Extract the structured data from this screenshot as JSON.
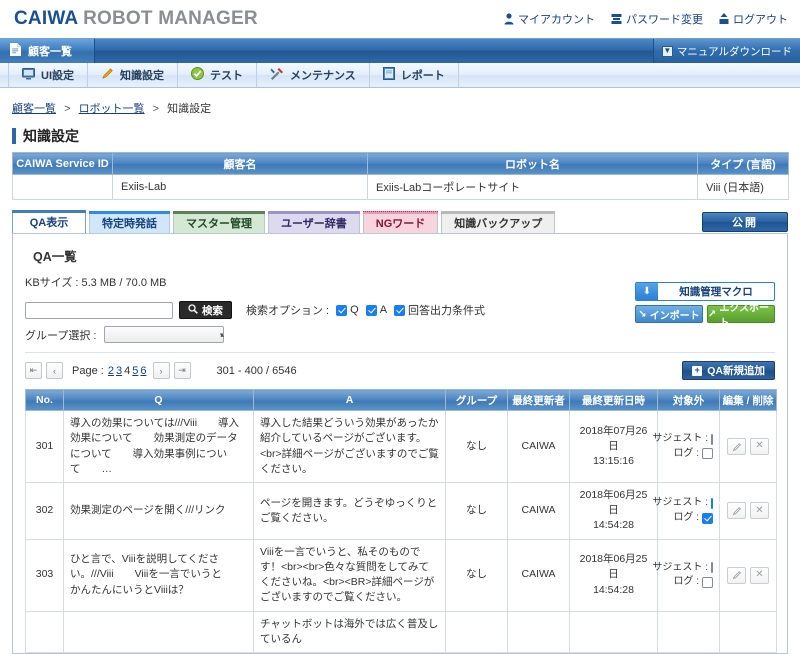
{
  "header": {
    "brand_primary": "CAIWA",
    "brand_secondary": "ROBOT MANAGER",
    "links": [
      {
        "label": "マイアカウント",
        "icon": "user-icon"
      },
      {
        "label": "パスワード変更",
        "icon": "keyboard-icon"
      },
      {
        "label": "ログアウト",
        "icon": "logout-icon"
      }
    ]
  },
  "navbar": {
    "active_tab": "顧客一覧",
    "manual_download": "マニュアルダウンロード",
    "items": [
      {
        "label": "UI設定",
        "icon": "monitor-icon"
      },
      {
        "label": "知識設定",
        "icon": "pencil-icon"
      },
      {
        "label": "テスト",
        "icon": "check-circle-icon"
      },
      {
        "label": "メンテナンス",
        "icon": "tools-icon"
      },
      {
        "label": "レポート",
        "icon": "book-icon"
      }
    ]
  },
  "breadcrumb": {
    "item1": "顧客一覧",
    "sep1": ">",
    "item2": "ロボット一覧",
    "sep2": ">",
    "current": "知識設定"
  },
  "page_title": "知識設定",
  "info_table": {
    "headers": [
      "CAIWA Service ID",
      "顧客名",
      "ロボット名",
      "タイプ (言語)"
    ],
    "row": [
      "",
      "Exiis-Lab",
      "Exiis-Labコーポレートサイト",
      "Viii (日本語)"
    ]
  },
  "tabs": [
    {
      "label": "QA表示",
      "style": "active"
    },
    {
      "label": "特定時発話",
      "style": "t-blue"
    },
    {
      "label": "マスター管理",
      "style": "t-green"
    },
    {
      "label": "ユーザー辞書",
      "style": "t-purple"
    },
    {
      "label": "NGワード",
      "style": "t-pink"
    },
    {
      "label": "知識バックアップ",
      "style": "t-grey"
    }
  ],
  "publish_button": "公開",
  "panel": {
    "title": "QA一覧",
    "kb_size": "KBサイズ : 5.3 MB / 70.0 MB",
    "search": {
      "value": "",
      "placeholder": "",
      "button_label": "検索",
      "button_icon": "search-icon",
      "options_label": "検索オプション :",
      "options": [
        {
          "label": "Q",
          "checked": true
        },
        {
          "label": "A",
          "checked": true
        },
        {
          "label": "回答出力条件式",
          "checked": true
        }
      ]
    },
    "group_select": {
      "label": "グループ選択 :",
      "value": ""
    },
    "macro": {
      "main_label": "知識管理マクロ",
      "main_icon": "download-icon",
      "import_label": "インポート",
      "import_icon": "import-icon",
      "export_label": "エクスポート",
      "export_icon": "export-icon"
    },
    "pagination": {
      "first_icon": "⏪",
      "prev_icon": "‹",
      "next_icon": "›",
      "last_icon": "⏩",
      "label": "Page :",
      "pages": [
        {
          "num": "2",
          "current": false
        },
        {
          "num": "3",
          "current": false
        },
        {
          "num": "4",
          "current": true
        },
        {
          "num": "5",
          "current": false
        },
        {
          "num": "6",
          "current": false
        }
      ],
      "range": "301 - 400 / 6546"
    },
    "add_button": {
      "label": "QA新規追加",
      "icon": "plus-icon"
    }
  },
  "qa_table": {
    "headers": [
      "No.",
      "Q",
      "A",
      "グループ",
      "最終更新者",
      "最終更新日時",
      "対象外",
      "編集 / 削除"
    ],
    "target_labels": {
      "suggest": "サジェスト :",
      "log": "ログ :"
    },
    "rows": [
      {
        "no": "301",
        "q": "導入の効果については///Viii　　導入効果について　　効果測定のデータについて　　導入効果事例について　　…",
        "a": "導入した結果どういう効果があったか紹介しているページがございます。<br>詳細ページがございますのでご覧ください。",
        "group": "なし",
        "updater": "CAIWA",
        "updated_date": "2018年07月26日",
        "updated_time": "13:15:16",
        "suggest_checked": false,
        "log_checked": false,
        "edit_icon": "pencil-icon",
        "delete_icon": "close-icon"
      },
      {
        "no": "302",
        "q": "効果測定のページを開く///リンク",
        "a": "ページを開きます。どうぞゆっくりとご覧ください。",
        "group": "なし",
        "updater": "CAIWA",
        "updated_date": "2018年06月25日",
        "updated_time": "14:54:28",
        "suggest_checked": true,
        "log_checked": true,
        "edit_icon": "pencil-icon",
        "delete_icon": "close-icon"
      },
      {
        "no": "303",
        "q": "ひと言で、Viiiを説明してください。///Viii　　Viiiを一言でいうと　　かんたんにいうとViiiは？",
        "a": "Viiiを一言でいうと、私そのものです！<br><br>色々な質問をしてみてくださいね。<br><BR>詳細ページがございますのでご覧ください。",
        "group": "なし",
        "updater": "CAIWA",
        "updated_date": "2018年06月25日",
        "updated_time": "14:54:28",
        "suggest_checked": false,
        "log_checked": false,
        "edit_icon": "pencil-icon",
        "delete_icon": "close-icon"
      },
      {
        "no": "",
        "q": "",
        "a": "チャットボットは海外では広く普及しているん",
        "group": "",
        "updater": "",
        "updated_date": "",
        "updated_time": "",
        "suggest_checked": false,
        "log_checked": false,
        "edit_icon": "",
        "delete_icon": ""
      }
    ]
  }
}
